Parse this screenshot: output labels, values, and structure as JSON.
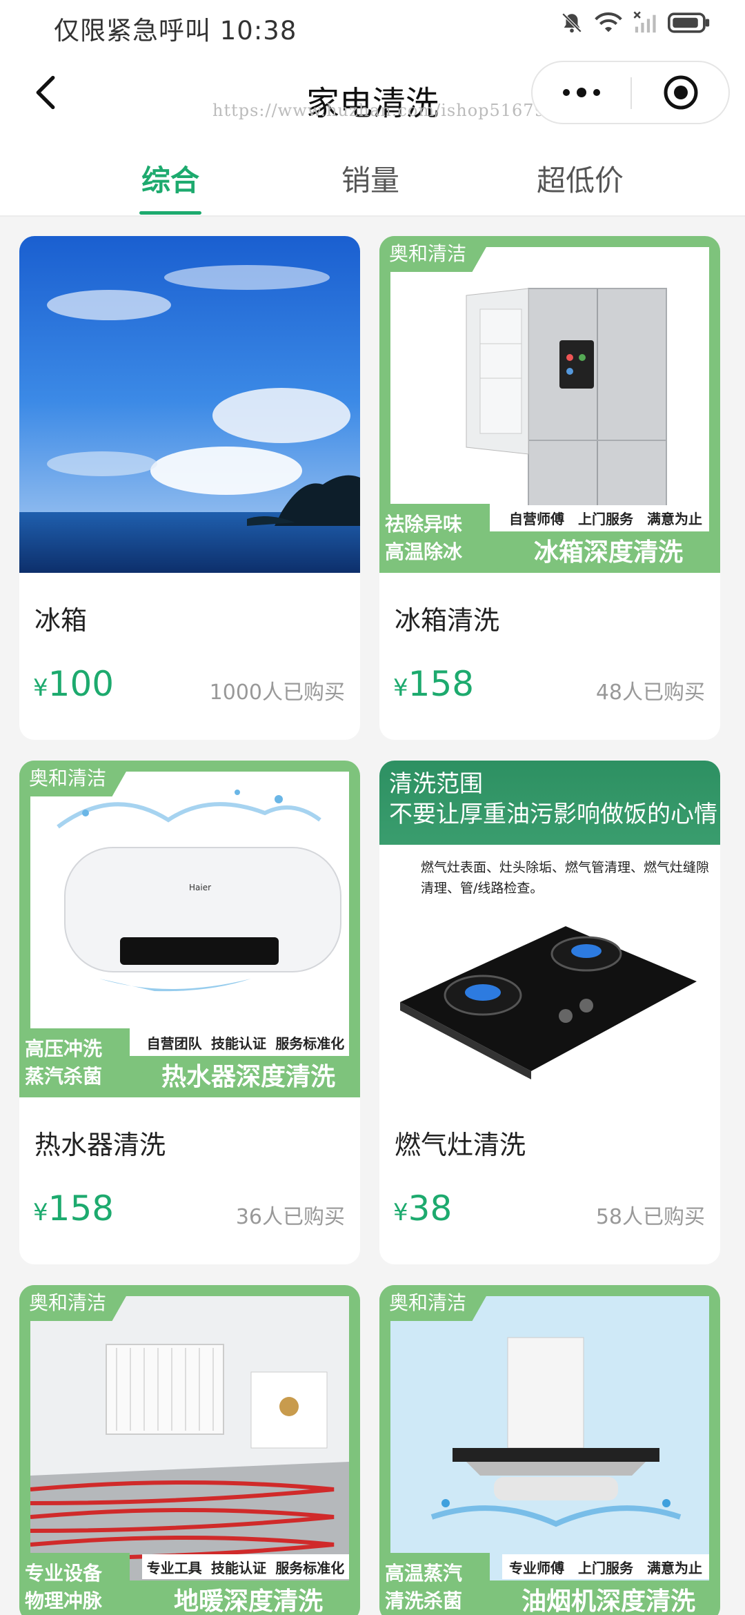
{
  "status_bar": {
    "left_text": "仅限紧急呼叫 10:38"
  },
  "nav": {
    "title": "家电清洗",
    "watermark": "https://www.huzhan.com/ishop51679"
  },
  "tabs": [
    {
      "label": "综合",
      "active": true
    },
    {
      "label": "销量",
      "active": false
    },
    {
      "label": "超低价",
      "active": false
    }
  ],
  "products": [
    {
      "name": "冰箱",
      "price_symbol": "¥",
      "price": "100",
      "sold": "1000人已购买"
    },
    {
      "name": "冰箱清洗",
      "price_symbol": "¥",
      "price": "158",
      "sold": "48人已购买",
      "image": {
        "brand": "奥和清洁",
        "badge_line1": "祛除异味",
        "badge_line2": "高温除冰",
        "services": [
          "自营师傅",
          "上门服务",
          "满意为止"
        ],
        "banner": "冰箱深度清洗"
      }
    },
    {
      "name": "热水器清洗",
      "price_symbol": "¥",
      "price": "158",
      "sold": "36人已购买",
      "image": {
        "brand": "奥和清洁",
        "badge_line1": "高压冲洗",
        "badge_line2": "蒸汽杀菌",
        "services": [
          "自营团队",
          "技能认证",
          "服务标准化"
        ],
        "banner": "热水器深度清洗",
        "logo": "Haier"
      }
    },
    {
      "name": "燃气灶清洗",
      "price_symbol": "¥",
      "price": "38",
      "sold": "58人已购买",
      "image": {
        "header_line1": "清洗范围",
        "header_line2": "不要让厚重油污影响做饭的心情",
        "desc": "燃气灶表面、灶头除垢、燃气管清理、燃气灶缝隙清理、管/线路检查。"
      }
    },
    {
      "name": "",
      "image": {
        "brand": "奥和清洁",
        "badge_line1": "专业设备",
        "badge_line2": "物理冲脉",
        "services": [
          "专业工具",
          "技能认证",
          "服务标准化"
        ],
        "banner": "地暖深度清洗"
      }
    },
    {
      "name": "",
      "image": {
        "brand": "奥和清洁",
        "badge_line1": "高温蒸汽",
        "badge_line2": "清洗杀菌",
        "services": [
          "专业师傅",
          "上门服务",
          "满意为止"
        ],
        "banner": "油烟机深度清洗"
      }
    }
  ],
  "colors": {
    "accent": "#1daa6e",
    "frame_green": "#7ec37c"
  },
  "icons": {
    "back": "chevron-left-icon",
    "more": "more-dots-icon",
    "close": "target-circle-icon",
    "mute": "bell-off-icon",
    "wifi": "wifi-icon",
    "signal": "signal-icon",
    "battery": "battery-icon"
  }
}
